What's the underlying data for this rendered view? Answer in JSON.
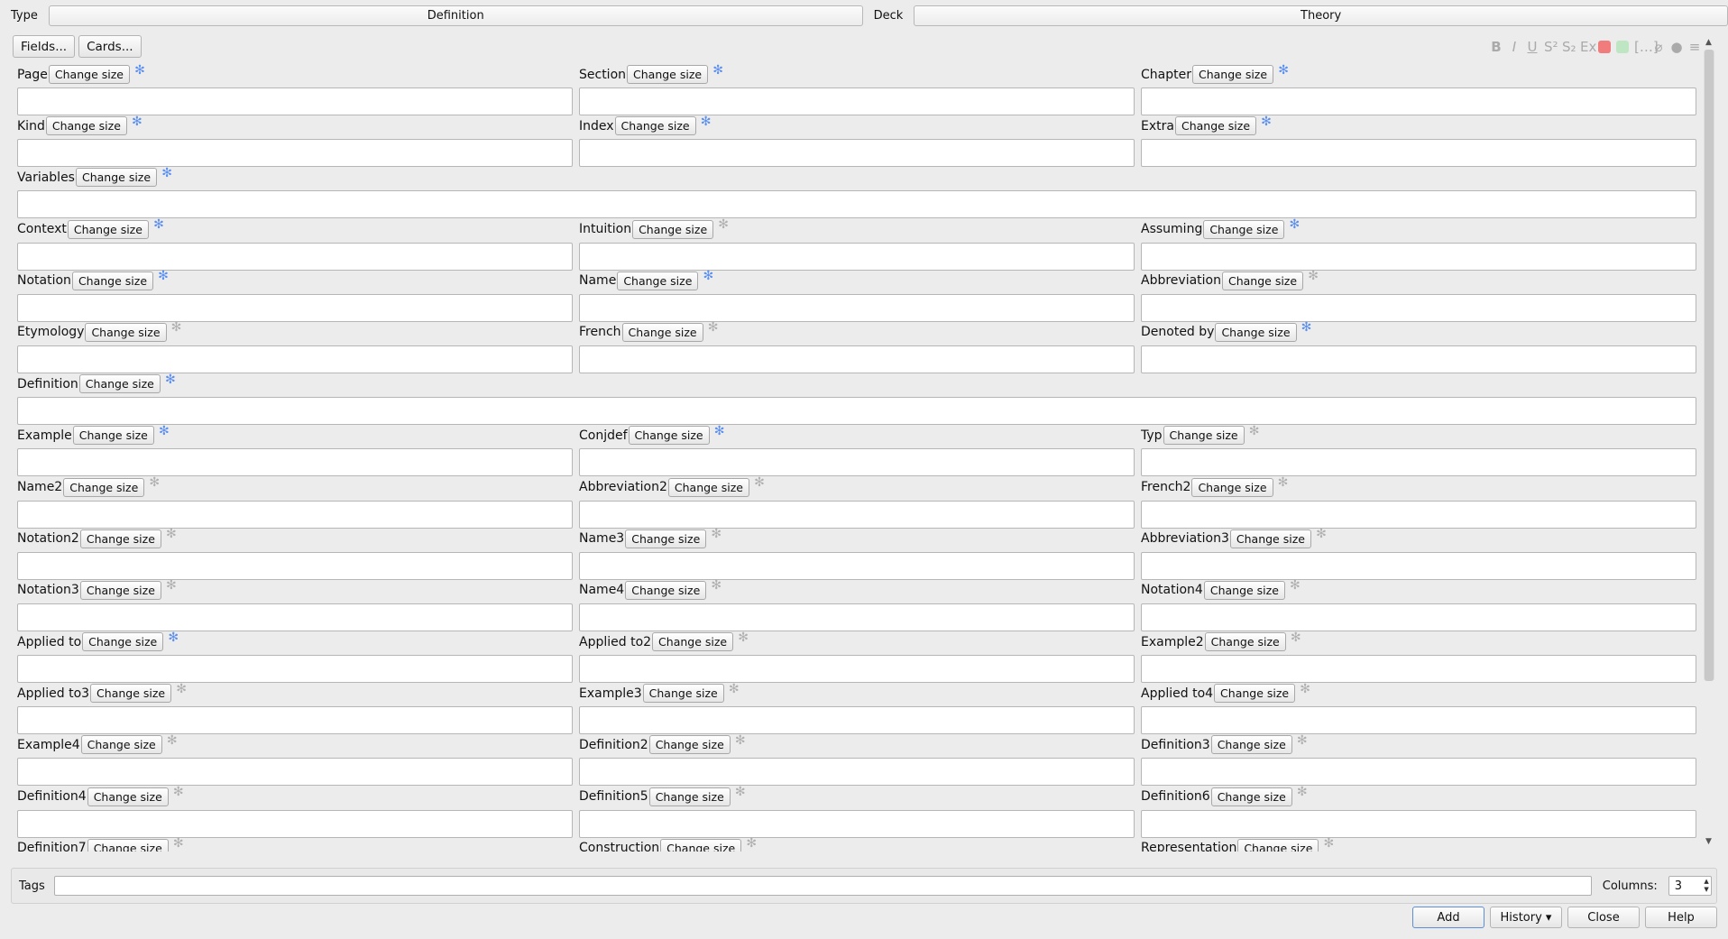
{
  "header": {
    "type_label": "Type",
    "type_value": "Definition",
    "deck_label": "Deck",
    "deck_value": "Theory"
  },
  "toolbar": {
    "fields_label": "Fields...",
    "cards_label": "Cards...",
    "format_icons": [
      "bold-icon",
      "italic-icon",
      "underline-icon",
      "superscript-icon",
      "subscript-icon",
      "clear-format-icon",
      "text-color-icon",
      "highlight-color-icon",
      "cloze-icon",
      "attach-icon",
      "record-audio-icon",
      "more-icon"
    ],
    "colors": {
      "text_color": "#f07c7c",
      "highlight": "#bfe6c3"
    }
  },
  "change_size_label": "Change size",
  "fields": [
    {
      "name": "Page",
      "sticky": true
    },
    {
      "name": "Section",
      "sticky": true
    },
    {
      "name": "Chapter",
      "sticky": true
    },
    {
      "name": "Kind",
      "sticky": true
    },
    {
      "name": "Index",
      "sticky": true
    },
    {
      "name": "Extra",
      "sticky": true
    },
    {
      "name": "Variables",
      "sticky": true,
      "full": true
    },
    {
      "name": "Context",
      "sticky": true
    },
    {
      "name": "Intuition",
      "sticky": false
    },
    {
      "name": "Assuming",
      "sticky": true
    },
    {
      "name": "Notation",
      "sticky": true
    },
    {
      "name": "Name",
      "sticky": true
    },
    {
      "name": "Abbreviation",
      "sticky": false
    },
    {
      "name": "Etymology",
      "sticky": false
    },
    {
      "name": "French",
      "sticky": false
    },
    {
      "name": "Denoted by",
      "sticky": true
    },
    {
      "name": "Definition",
      "sticky": true,
      "full": true
    },
    {
      "name": "Example",
      "sticky": true
    },
    {
      "name": "Conjdef",
      "sticky": true
    },
    {
      "name": "Typ",
      "sticky": false
    },
    {
      "name": "Name2",
      "sticky": false
    },
    {
      "name": "Abbreviation2",
      "sticky": false
    },
    {
      "name": "French2",
      "sticky": false
    },
    {
      "name": "Notation2",
      "sticky": false
    },
    {
      "name": "Name3",
      "sticky": false
    },
    {
      "name": "Abbreviation3",
      "sticky": false
    },
    {
      "name": "Notation3",
      "sticky": false
    },
    {
      "name": "Name4",
      "sticky": false
    },
    {
      "name": "Notation4",
      "sticky": false
    },
    {
      "name": "Applied to",
      "sticky": true
    },
    {
      "name": "Applied to2",
      "sticky": false
    },
    {
      "name": "Example2",
      "sticky": false
    },
    {
      "name": "Applied to3",
      "sticky": false
    },
    {
      "name": "Example3",
      "sticky": false
    },
    {
      "name": "Applied to4",
      "sticky": false
    },
    {
      "name": "Example4",
      "sticky": false
    },
    {
      "name": "Definition2",
      "sticky": false
    },
    {
      "name": "Definition3",
      "sticky": false
    },
    {
      "name": "Definition4",
      "sticky": false
    },
    {
      "name": "Definition5",
      "sticky": false
    },
    {
      "name": "Definition6",
      "sticky": false
    },
    {
      "name": "Definition7",
      "sticky": false
    },
    {
      "name": "Construction",
      "sticky": false
    },
    {
      "name": "Representation",
      "sticky": false
    }
  ],
  "tags": {
    "label": "Tags",
    "value": ""
  },
  "columns": {
    "label": "Columns:",
    "value": "3"
  },
  "buttons": {
    "add": "Add",
    "history": "History ▾",
    "close": "Close",
    "help": "Help"
  }
}
